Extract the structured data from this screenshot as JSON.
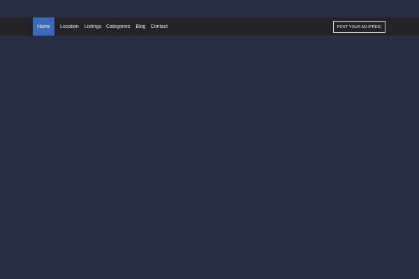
{
  "colors": {
    "page_background": "#272d45",
    "navbar_background": "#232224",
    "active_nav_background": "#3b68b8",
    "text": "#e9e9ee",
    "button_border": "#d9d9dd"
  },
  "navbar": {
    "items": [
      {
        "label": "Home",
        "active": true
      },
      {
        "label": "Location",
        "active": false
      },
      {
        "label": "Listings",
        "active": false
      },
      {
        "label": "Categories",
        "active": false
      },
      {
        "label": "Blog",
        "active": false
      },
      {
        "label": "Contact",
        "active": false
      }
    ],
    "post_button_label": "POST YOUR AD (FREE)"
  }
}
